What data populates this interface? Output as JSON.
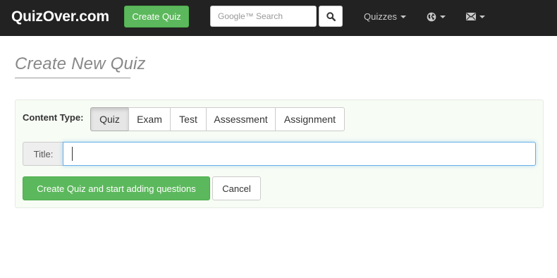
{
  "navbar": {
    "brand": "QuizOver.com",
    "create_button": "Create Quiz",
    "search": {
      "placeholder": "Google™ Search",
      "value": ""
    },
    "search_button_icon": "search-icon",
    "quizzes_menu": "Quizzes",
    "globe_menu_icon": "globe-icon",
    "mail_menu_icon": "envelope-icon"
  },
  "page": {
    "title": "Create New Quiz"
  },
  "form": {
    "content_type_label": "Content Type:",
    "content_types": [
      {
        "label": "Quiz",
        "active": true
      },
      {
        "label": "Exam",
        "active": false
      },
      {
        "label": "Test",
        "active": false
      },
      {
        "label": "Assessment",
        "active": false
      },
      {
        "label": "Assignment",
        "active": false
      }
    ],
    "title_label": "Title:",
    "title_value": "",
    "submit_button": "Create Quiz and start adding questions",
    "cancel_button": "Cancel"
  },
  "colors": {
    "navbar_bg": "#222222",
    "success": "#5cb85c",
    "well_bg": "#f7fcf5",
    "focus_border": "#66afe9"
  }
}
